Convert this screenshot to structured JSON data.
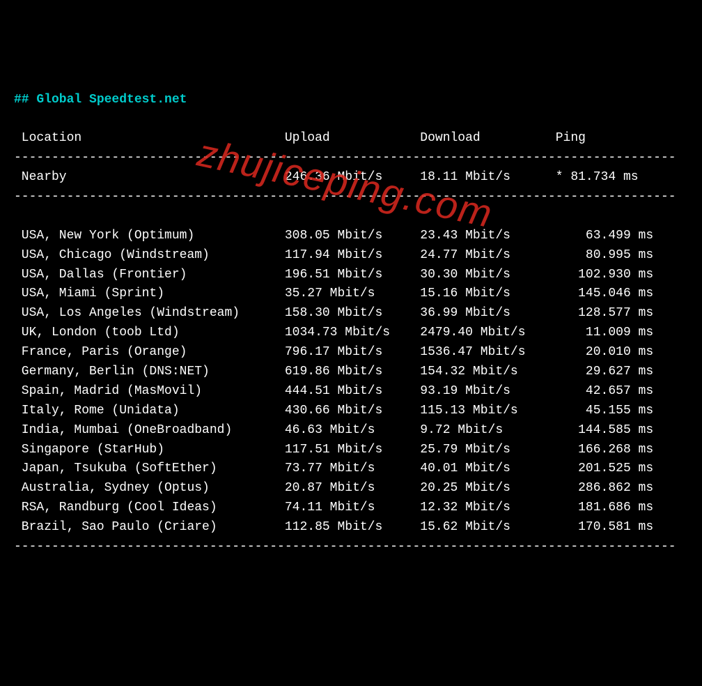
{
  "title": "## Global Speedtest.net",
  "columns": {
    "location": "Location",
    "upload": "Upload",
    "download": "Download",
    "ping": "Ping"
  },
  "separator_line": "----------------------------------------------------------------------------------------",
  "nearby": {
    "name": "Nearby",
    "upload": "246.36 Mbit/s",
    "download": "18.11 Mbit/s",
    "ping": "* 81.734 ms"
  },
  "rows": [
    {
      "name": "USA, New York (Optimum)",
      "upload": "308.05 Mbit/s",
      "download": "23.43 Mbit/s",
      "ping": "63.499 ms"
    },
    {
      "name": "USA, Chicago (Windstream)",
      "upload": "117.94 Mbit/s",
      "download": "24.77 Mbit/s",
      "ping": "80.995 ms"
    },
    {
      "name": "USA, Dallas (Frontier)",
      "upload": "196.51 Mbit/s",
      "download": "30.30 Mbit/s",
      "ping": "102.930 ms"
    },
    {
      "name": "USA, Miami (Sprint)",
      "upload": "35.27 Mbit/s",
      "download": "15.16 Mbit/s",
      "ping": "145.046 ms"
    },
    {
      "name": "USA, Los Angeles (Windstream)",
      "upload": "158.30 Mbit/s",
      "download": "36.99 Mbit/s",
      "ping": "128.577 ms"
    },
    {
      "name": "UK, London (toob Ltd)",
      "upload": "1034.73 Mbit/s",
      "download": "2479.40 Mbit/s",
      "ping": "11.009 ms"
    },
    {
      "name": "France, Paris (Orange)",
      "upload": "796.17 Mbit/s",
      "download": "1536.47 Mbit/s",
      "ping": "20.010 ms"
    },
    {
      "name": "Germany, Berlin (DNS:NET)",
      "upload": "619.86 Mbit/s",
      "download": "154.32 Mbit/s",
      "ping": "29.627 ms"
    },
    {
      "name": "Spain, Madrid (MasMovil)",
      "upload": "444.51 Mbit/s",
      "download": "93.19 Mbit/s",
      "ping": "42.657 ms"
    },
    {
      "name": "Italy, Rome (Unidata)",
      "upload": "430.66 Mbit/s",
      "download": "115.13 Mbit/s",
      "ping": "45.155 ms"
    },
    {
      "name": "India, Mumbai (OneBroadband)",
      "upload": "46.63 Mbit/s",
      "download": "9.72 Mbit/s",
      "ping": "144.585 ms"
    },
    {
      "name": "Singapore (StarHub)",
      "upload": "117.51 Mbit/s",
      "download": "25.79 Mbit/s",
      "ping": "166.268 ms"
    },
    {
      "name": "Japan, Tsukuba (SoftEther)",
      "upload": "73.77 Mbit/s",
      "download": "40.01 Mbit/s",
      "ping": "201.525 ms"
    },
    {
      "name": "Australia, Sydney (Optus)",
      "upload": "20.87 Mbit/s",
      "download": "20.25 Mbit/s",
      "ping": "286.862 ms"
    },
    {
      "name": "RSA, Randburg (Cool Ideas)",
      "upload": "74.11 Mbit/s",
      "download": "12.32 Mbit/s",
      "ping": "181.686 ms"
    },
    {
      "name": "Brazil, Sao Paulo (Criare)",
      "upload": "112.85 Mbit/s",
      "download": "15.62 Mbit/s",
      "ping": "170.581 ms"
    }
  ],
  "watermark": "zhujiceping.com",
  "layout": {
    "col_location_width": 35,
    "col_upload_width": 18,
    "col_download_width": 18,
    "col_ping_width": 13
  }
}
